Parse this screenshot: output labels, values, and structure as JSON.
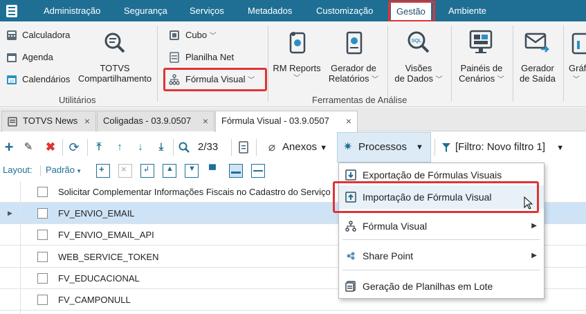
{
  "menubar": {
    "items": [
      "Administração",
      "Segurança",
      "Serviços",
      "Metadados",
      "Customização",
      "Gestão",
      "Ambiente"
    ],
    "active": "Gestão"
  },
  "ribbon": {
    "utilities": {
      "calculadora": "Calculadora",
      "agenda": "Agenda",
      "calendarios": "Calendários",
      "totvs_line1": "TOTVS",
      "totvs_line2": "Compartilhamento",
      "label": "Utilitários"
    },
    "analysis": {
      "cubo": "Cubo",
      "planilha": "Planilha Net",
      "formula": "Fórmula Visual",
      "rm_reports": "RM Reports",
      "gerador_rel_1": "Gerador de",
      "gerador_rel_2": "Relatórios",
      "visoes_1": "Visões",
      "visoes_2": "de Dados",
      "paineis_1": "Painéis de",
      "paineis_2": "Cenários",
      "gerador_saida_1": "Gerador",
      "gerador_saida_2": "de Saída",
      "graficos": "Gráf",
      "label": "Ferramentas de Análise"
    },
    "colors": {
      "accent": "#1f6f94",
      "highlight": "#e03333"
    }
  },
  "tabs": [
    {
      "label": "TOTVS News",
      "close": "×"
    },
    {
      "label": "Coligadas - 03.9.0507",
      "close": "×"
    },
    {
      "label": "Fórmula Visual - 03.9.0507",
      "close": "×"
    }
  ],
  "toolbar": {
    "counter": "2/33",
    "anexos": "Anexos",
    "processos": "Processos",
    "filtro": "[Filtro: Novo filtro 1]"
  },
  "layoutbar": {
    "layout_label": "Layout:",
    "padrao": "Padrão"
  },
  "grid": {
    "rows": [
      "Solicitar Complementar Informações Fiscais no Cadastro do Serviço",
      "FV_ENVIO_EMAIL",
      "FV_ENVIO_EMAIL_API",
      "WEB_SERVICE_TOKEN",
      "FV_EDUCACIONAL",
      "FV_CAMPONULL"
    ],
    "selected_index": 1
  },
  "dropdown": {
    "items": [
      "Exportação de Fórmulas Visuais",
      "Importação de Fórmula Visual",
      "Fórmula Visual",
      "Share Point",
      "Geração de Planilhas em Lote"
    ]
  }
}
